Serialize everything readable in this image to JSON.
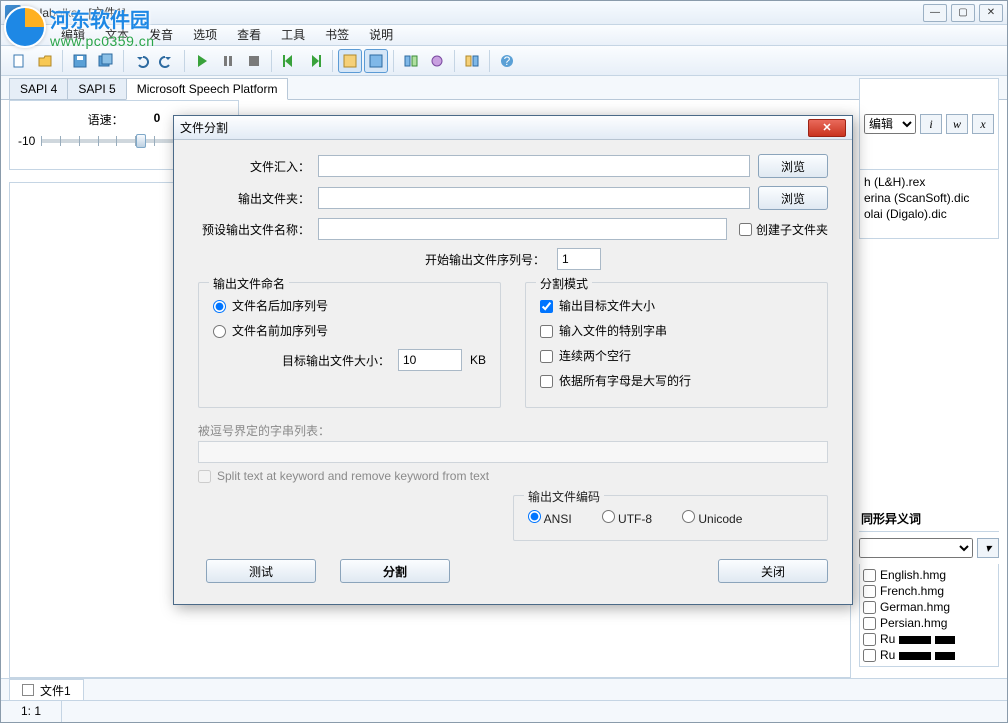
{
  "window": {
    "title": "Balabolka - [文件1]",
    "buttons": {
      "min": "—",
      "max": "▢",
      "close": "✕"
    }
  },
  "watermark": {
    "name": "河东软件园",
    "url": "www.pc0359.cn"
  },
  "menu": [
    "文件",
    "编辑",
    "文本",
    "发音",
    "选项",
    "查看",
    "工具",
    "书签",
    "说明"
  ],
  "engine_tabs": [
    "SAPI 4",
    "SAPI 5",
    "Microsoft Speech Platform"
  ],
  "speed": {
    "label": "语速：",
    "value": "0",
    "min": "-10"
  },
  "right": {
    "edit_label": "编辑",
    "btn_i": "i",
    "btn_w": "w",
    "btn_x": "x",
    "dic_items": [
      "h (L&H).rex",
      "erina (ScanSoft).dic",
      "olai (Digalo).dic"
    ]
  },
  "side": {
    "title": "同形异义词",
    "items": [
      "English.hmg",
      "French.hmg",
      "German.hmg",
      "Persian.hmg",
      "Ru",
      "Ru"
    ]
  },
  "file_tab": "文件1",
  "status": {
    "pos": "1:  1"
  },
  "dialog": {
    "title": "文件分割",
    "labels": {
      "file_in": "文件汇入：",
      "out_folder": "输出文件夹：",
      "preset_name": "预设输出文件名称：",
      "create_sub": "创建子文件夹",
      "start_seq": "开始输出文件序列号：",
      "naming_group": "输出文件命名",
      "naming_after": "文件名后加序列号",
      "naming_before": "文件名前加序列号",
      "target_size": "目标输出文件大小：",
      "kb": "KB",
      "mode_group": "分割模式",
      "mode_size": "输出目标文件大小",
      "mode_special": "输入文件的特别字串",
      "mode_blank": "连续两个空行",
      "mode_caps": "依据所有字母是大写的行",
      "list_label": "被逗号界定的字串列表：",
      "split_keyword": "Split text at keyword and remove keyword from text",
      "encoding_group": "输出文件编码",
      "enc_ansi": "ANSI",
      "enc_utf8": "UTF-8",
      "enc_unicode": "Unicode"
    },
    "values": {
      "start_seq": "1",
      "target_size": "10"
    },
    "buttons": {
      "browse": "浏览",
      "test": "测试",
      "split": "分割",
      "close": "关闭"
    }
  }
}
